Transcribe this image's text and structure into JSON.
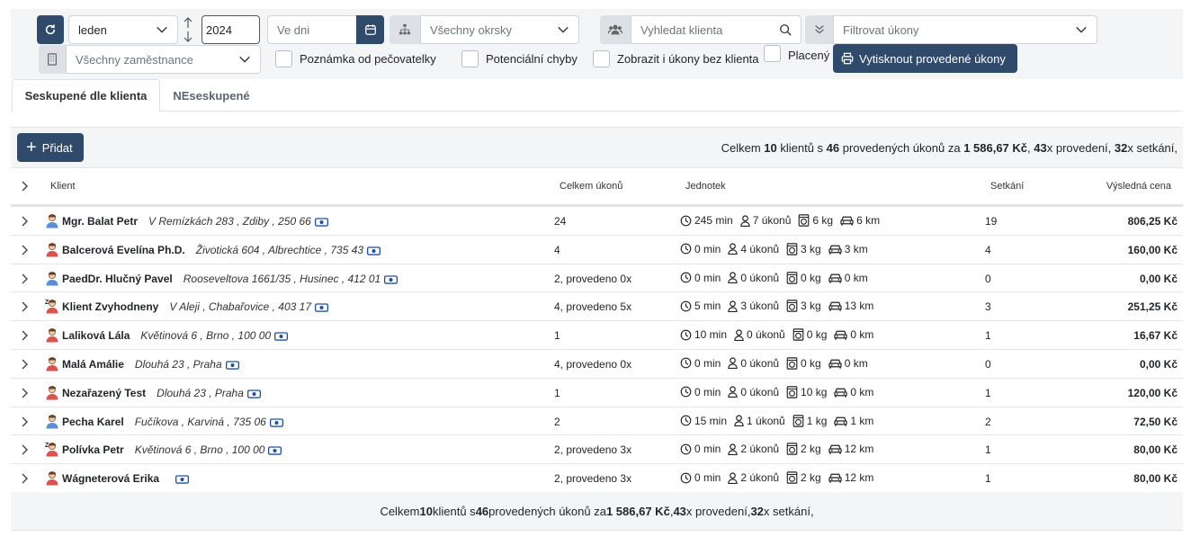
{
  "filters": {
    "month": "leden",
    "year": "2024",
    "days_placeholder": "Ve dni",
    "districts_placeholder": "Všechny okrsky",
    "client_search_placeholder": "Vyhledat klienta",
    "tasks_filter_placeholder": "Filtrovat úkony",
    "employees_placeholder": "Všechny zaměstnance",
    "checkboxes": [
      {
        "label": "Poznámka od pečovatelky",
        "checked": false
      },
      {
        "label": "Potenciální chyby",
        "checked": false
      },
      {
        "label": "Zobrazit i úkony bez klienta",
        "checked": false
      },
      {
        "label": "Placený",
        "checked": false
      }
    ],
    "print_button": "Vytisknout provedené úkony"
  },
  "tabs": [
    {
      "label": "Seskupené dle klienta",
      "active": true
    },
    {
      "label": "NEseskupené",
      "active": false
    }
  ],
  "toolbar": {
    "add_label": "Přidat",
    "summary": {
      "p1": "Celkem ",
      "clients": "10",
      "p2": " klientů s ",
      "tasks": "46",
      "p3": " provedených úkonů za ",
      "price": "1 586,67 Kč",
      "p4": ", ",
      "executions": "43",
      "p5": "x provedení, ",
      "meetings": "32",
      "p6": "x setkání,"
    }
  },
  "table": {
    "headers": {
      "client": "Klient",
      "total": "Celkem úkonů",
      "units": "Jednotek",
      "meetings": "Setkání",
      "price": "Výsledná cena"
    },
    "rows": [
      {
        "avatar": "male",
        "name": "Mgr. Balat Petr",
        "address": "V Remízkách 283 , Zdiby , 250 66",
        "total": "24",
        "min": "245 min",
        "tasks": "7 úkonů",
        "kg": "6 kg",
        "km": "6 km",
        "meetings": "19",
        "price": "806,25 Kč"
      },
      {
        "avatar": "female",
        "name": "Balcerová Evelína Ph.D.",
        "address": "Životická 604 , Albrechtice , 735 43",
        "total": "4",
        "min": "0 min",
        "tasks": "4 úkonů",
        "kg": "3 kg",
        "km": "3 km",
        "meetings": "4",
        "price": "160,00 Kč"
      },
      {
        "avatar": "male",
        "name": "PaedDr. Hlučný Pavel",
        "address": "Rooseveltova 1661/35 , Husinec , 412 01",
        "total": "2, provedeno 0x",
        "min": "0 min",
        "tasks": "0 úkonů",
        "kg": "0 kg",
        "km": "0 km",
        "meetings": "0",
        "price": "0,00 Kč"
      },
      {
        "avatar": "sleep",
        "name": "Klient Zvyhodneny",
        "address": "V Aleji , Chabařovice , 403 17",
        "total": "4, provedeno 5x",
        "min": "5 min",
        "tasks": "3 úkonů",
        "kg": "3 kg",
        "km": "13 km",
        "meetings": "3",
        "price": "251,25 Kč"
      },
      {
        "avatar": "female",
        "name": "Laliková Lála",
        "address": "Květinová 6 , Brno , 100 00",
        "total": "1",
        "min": "10 min",
        "tasks": "0 úkonů",
        "kg": "0 kg",
        "km": "0 km",
        "meetings": "1",
        "price": "16,67 Kč"
      },
      {
        "avatar": "female",
        "name": "Malá Amálie",
        "address": "Dlouhá 23 , Praha",
        "total": "4, provedeno 0x",
        "min": "0 min",
        "tasks": "0 úkonů",
        "kg": "0 kg",
        "km": "0 km",
        "meetings": "0",
        "price": "0,00 Kč"
      },
      {
        "avatar": "female",
        "name": "Nezařazený Test",
        "address": "Dlouhá 23 , Praha",
        "total": "1",
        "min": "0 min",
        "tasks": "0 úkonů",
        "kg": "10 kg",
        "km": "0 km",
        "meetings": "1",
        "price": "120,00 Kč"
      },
      {
        "avatar": "male",
        "name": "Pecha Karel",
        "address": "Fučíkova , Karviná , 735 06",
        "total": "2",
        "min": "15 min",
        "tasks": "1 úkonů",
        "kg": "1 kg",
        "km": "1 km",
        "meetings": "2",
        "price": "72,50 Kč"
      },
      {
        "avatar": "sleep",
        "name": "Polívka Petr",
        "address": "Květinová 6 , Brno , 100 00",
        "total": "2, provedeno 3x",
        "min": "0 min",
        "tasks": "2 úkonů",
        "kg": "2 kg",
        "km": "12 km",
        "meetings": "1",
        "price": "80,00 Kč"
      },
      {
        "avatar": "female",
        "name": "Wágneterová Erika",
        "address": "",
        "total": "2, provedeno 3x",
        "min": "0 min",
        "tasks": "2 úkonů",
        "kg": "2 kg",
        "km": "12 km",
        "meetings": "1",
        "price": "80,00 Kč"
      }
    ]
  },
  "colors": {
    "primary": "#2f4a6b",
    "panel": "#f4f5f6",
    "male_avatar": "#5a8fd6",
    "female_avatar": "#d9534f"
  }
}
